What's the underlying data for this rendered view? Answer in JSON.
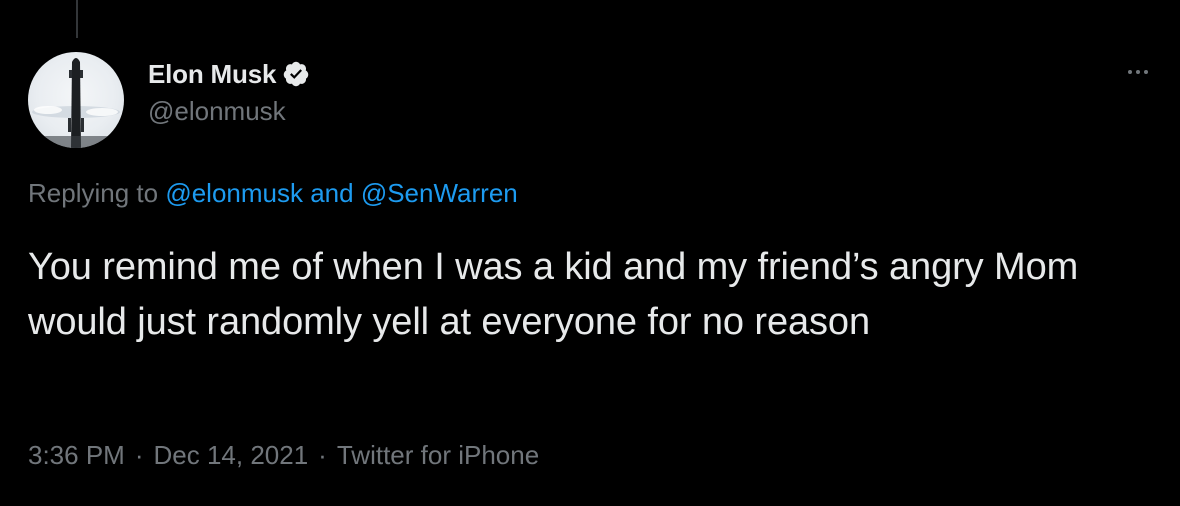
{
  "user": {
    "display_name": "Elon Musk",
    "handle": "@elonmusk",
    "verified": true,
    "avatar_icon": "starship-avatar"
  },
  "reply": {
    "prefix": "Replying to ",
    "mention_1": "@elonmusk",
    "conjunction": " and ",
    "mention_2": "@SenWarren"
  },
  "tweet": {
    "text": "You remind me of when I was a kid and my friend’s angry Mom would just randomly yell at everyone for no reason"
  },
  "meta": {
    "time": "3:36 PM",
    "separator": "·",
    "date": "Dec 14, 2021",
    "source": "Twitter for iPhone"
  },
  "icons": {
    "more": "more-horizontal-icon",
    "verified": "verified-badge-icon"
  },
  "colors": {
    "background": "#000000",
    "text": "#e7e9ea",
    "secondary": "#71767b",
    "accent": "#1d9bf0"
  }
}
